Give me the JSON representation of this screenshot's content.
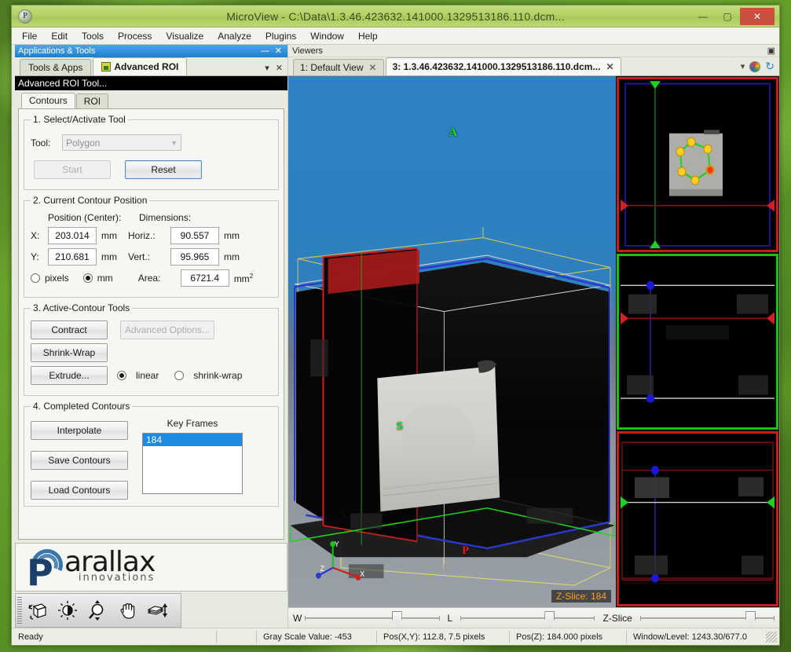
{
  "window": {
    "title": "MicroView - C:\\Data\\1.3.46.423632.141000.1329513186.110.dcm...",
    "app_icon": "microview-icon",
    "minimize": "—",
    "maximize": "▢",
    "close": "✕"
  },
  "menu": [
    "File",
    "Edit",
    "Tools",
    "Process",
    "Visualize",
    "Analyze",
    "Plugins",
    "Window",
    "Help"
  ],
  "left_dock": {
    "header_title": "Applications & Tools",
    "header_minimize": "—",
    "header_close": "✕",
    "tabs": [
      {
        "label": "Tools & Apps",
        "active": false,
        "icon": null
      },
      {
        "label": "Advanced ROI",
        "active": true,
        "icon": "roi-icon"
      }
    ],
    "strip_menu": "▾",
    "strip_close": "✕",
    "panel_title": "Advanced ROI Tool...",
    "inner_tabs": [
      {
        "label": "Contours",
        "active": true
      },
      {
        "label": "ROI",
        "active": false
      }
    ],
    "section1": {
      "legend": "1. Select/Activate Tool",
      "tool_label": "Tool:",
      "tool_value": "Polygon",
      "tool_options": [
        "Polygon"
      ],
      "start_label": "Start",
      "reset_label": "Reset"
    },
    "section2": {
      "legend": "2. Current Contour Position",
      "position_label": "Position (Center):",
      "dimensions_label": "Dimensions:",
      "x_label": "X:",
      "x_value": "203.014",
      "x_unit": "mm",
      "y_label": "Y:",
      "y_value": "210.681",
      "y_unit": "mm",
      "horiz_label": "Horiz.:",
      "horiz_value": "90.557",
      "horiz_unit": "mm",
      "vert_label": "Vert.:",
      "vert_value": "95.965",
      "vert_unit": "mm",
      "pixels_label": "pixels",
      "mm_label": "mm",
      "units_selected": "mm",
      "area_label": "Area:",
      "area_value": "6721.4",
      "area_unit": "mm",
      "area_unit_sup": "2"
    },
    "section3": {
      "legend": "3. Active-Contour Tools",
      "contract_label": "Contract",
      "advanced_options_label": "Advanced Options...",
      "shrink_wrap_label": "Shrink-Wrap",
      "extrude_label": "Extrude...",
      "linear_label": "linear",
      "shrinkwrap_radio_label": "shrink-wrap",
      "extrude_mode_selected": "linear"
    },
    "section4": {
      "legend": "4. Completed Contours",
      "interpolate_label": "Interpolate",
      "save_label": "Save Contours",
      "load_label": "Load Contours",
      "keyframes_label": "Key Frames",
      "keyframes": [
        "184"
      ]
    },
    "logo": {
      "brand_p": "P",
      "brand_rest": "arallax",
      "tagline": "innovations"
    },
    "toolbar_icons": [
      "rotate-cube-icon",
      "brightness-contrast-icon",
      "zoom-magnifier-icon",
      "pan-hand-icon",
      "slice-scroll-icon"
    ]
  },
  "viewers": {
    "header_title": "Viewers",
    "header_restore": "▣",
    "tabs": [
      {
        "label": "1: Default View",
        "active": false,
        "close": "✕"
      },
      {
        "label": "3: 1.3.46.423632.141000.1329513186.110.dcm...",
        "active": true,
        "close": "✕"
      }
    ],
    "menu_arrow": "▾",
    "palette_icon": "color-palette-icon",
    "refresh_icon": "refresh-icon",
    "view3d": {
      "orientation_anterior": "A",
      "orientation_superior": "S",
      "orientation_posterior": "P",
      "axis_x": "X",
      "axis_y": "Y",
      "axis_z": "Z",
      "zslice_badge": "Z-Slice: 184"
    },
    "thumbnails": [
      {
        "name": "axial-view",
        "border_color": "#c41e1e",
        "has_contour": true
      },
      {
        "name": "coronal-view",
        "border_color": "#18c018",
        "has_contour": false
      },
      {
        "name": "sagittal-view",
        "border_color": "#c41e1e",
        "has_contour": false
      }
    ]
  },
  "sliders": [
    {
      "label": "W",
      "position_pct": 68
    },
    {
      "label": "L",
      "position_pct": 66
    },
    {
      "label": "Z-Slice",
      "position_pct": 82
    }
  ],
  "statusbar": {
    "ready": "Ready",
    "gray_scale": "Gray Scale Value: -453",
    "pos_xy": "Pos(X,Y): 112.8, 7.5 pixels",
    "pos_z": "Pos(Z): 184.000 pixels",
    "window_level": "Window/Level: 1243.30/677.0"
  },
  "colors": {
    "title_bar": "#b2d264",
    "accent_blue": "#1d7fd0",
    "selection": "#1e8ae0",
    "close_red": "#c94f3e",
    "contour_green": "#18e018",
    "contour_vertex": "#f5d020",
    "badge_orange": "#ff9d2e"
  }
}
